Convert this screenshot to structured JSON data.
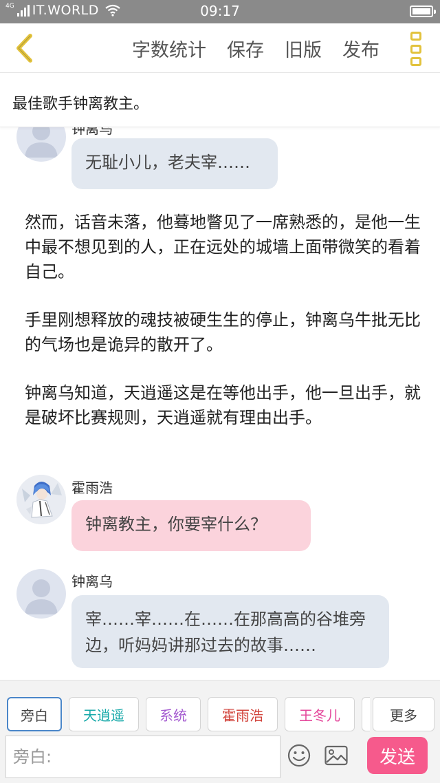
{
  "status_bar": {
    "network_tag": "4G",
    "carrier": "IT.WORLD",
    "time": "09:17"
  },
  "toolbar": {
    "actions": [
      "字数统计",
      "保存",
      "旧版",
      "发布"
    ],
    "accent_color": "#e2c23c"
  },
  "document": {
    "title": "最佳歌手钟离教主。"
  },
  "messages": [
    {
      "type": "dialog",
      "speaker": "钟离乌",
      "avatar": "default-avatar-icon",
      "text": "无耻小儿，老夫宰……",
      "bubble_color": "#e2e8f0"
    },
    {
      "type": "narration",
      "text": "然而，话音未落，他蓦地瞥见了一席熟悉的，是他一生中最不想见到的人，正在远处的城墙上面带微笑的看着自己。"
    },
    {
      "type": "narration",
      "text": "手里刚想释放的魂技被硬生生的停止，钟离乌牛批无比的气场也是诡异的散开了。"
    },
    {
      "type": "narration",
      "text": "钟离乌知道，天逍遥这是在等他出手，他一旦出手，就是破坏比赛规则，天逍遥就有理由出手。"
    },
    {
      "type": "dialog",
      "speaker": "霍雨浩",
      "avatar": "anime-avatar-photo",
      "text": "钟离教主，你要宰什么？",
      "bubble_color": "#fbd3dc"
    },
    {
      "type": "dialog",
      "speaker": "钟离乌",
      "avatar": "default-avatar-icon",
      "text": "宰……宰……在……在那高高的谷堆旁边，听妈妈讲那过去的故事……",
      "bubble_color": "#e2e8f0"
    }
  ],
  "role_tabs": [
    {
      "label": "旁白",
      "color": "#444444",
      "active": true
    },
    {
      "label": "天逍遥",
      "color": "#17a9a9",
      "active": false
    },
    {
      "label": "系统",
      "color": "#a45bd0",
      "active": false
    },
    {
      "label": "霍雨浩",
      "color": "#d2443c",
      "active": false
    },
    {
      "label": "王冬儿",
      "color": "#e4479b",
      "active": false
    },
    {
      "label": "更多",
      "color": "#444444",
      "active": false
    }
  ],
  "input": {
    "placeholder": "旁白:",
    "send_label": "发送",
    "send_color": "#f65a8c"
  }
}
